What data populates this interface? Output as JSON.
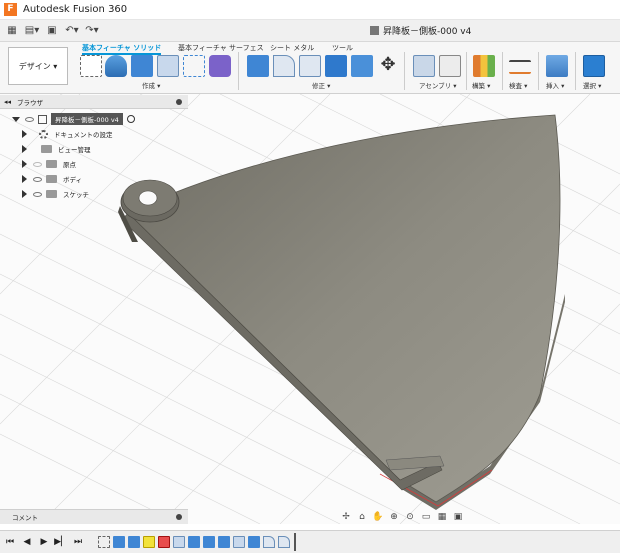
{
  "app": {
    "title": "Autodesk Fusion 360",
    "logo": "F"
  },
  "document": {
    "title": "昇降板－側板-000 v4"
  },
  "ribbon": {
    "workspace": "デザイン ▾",
    "tabs": [
      "基本フィーチャ ソリッド",
      "基本フィーチャ サーフェス",
      "シート メタル",
      "ツール"
    ],
    "groups": [
      "作成 ▾",
      "修正 ▾",
      "アセンブリ ▾",
      "構築 ▾",
      "検査 ▾",
      "挿入 ▾",
      "選択 ▾"
    ]
  },
  "browser": {
    "title": "ブラウザ",
    "root": "昇降板－側板-000 v4",
    "items": [
      "ドキュメントの設定",
      "ビュー管理",
      "原点",
      "ボディ",
      "スケッチ"
    ]
  },
  "comment": {
    "label": "コメント"
  },
  "colors": {
    "accent": "#0696d7",
    "part": "#87857c",
    "edge": "#d83a3a"
  }
}
